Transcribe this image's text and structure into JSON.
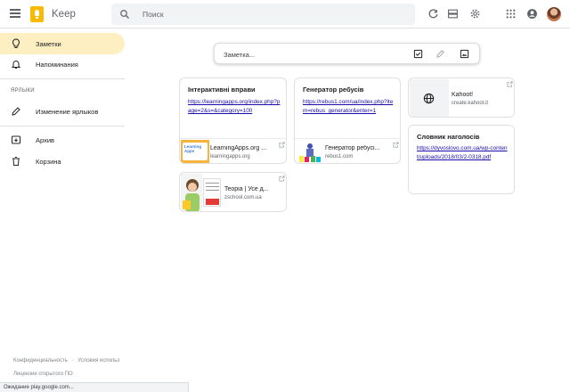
{
  "header": {
    "app_name": "Keep",
    "search_placeholder": "Поиск",
    "icons": [
      "menu-icon",
      "keep-logo-icon",
      "search-icon",
      "refresh-icon",
      "list-view-icon",
      "settings-icon",
      "apps-grid-icon",
      "account-icon"
    ]
  },
  "sidebar": {
    "items": [
      {
        "label": "Заметки",
        "icon": "lightbulb-icon",
        "active": true
      },
      {
        "label": "Напоминания",
        "icon": "bell-icon",
        "active": false
      }
    ],
    "labels_section_title": "ЯРЛЫКИ",
    "edit_labels": {
      "label": "Изменение ярлыков",
      "icon": "pencil-icon"
    },
    "archive": {
      "label": "Архив",
      "icon": "archive-icon"
    },
    "trash": {
      "label": "Корзина",
      "icon": "trash-icon"
    },
    "footer": {
      "privacy": "Конфиденциальность",
      "separator": "·",
      "terms": "Условия использ",
      "licenses": "Лицензии открытого ПО"
    }
  },
  "status_bar": "Ожидание play.google.com...",
  "composer": {
    "placeholder": "Заметка...",
    "icons": [
      "checkbox-list-icon",
      "drawing-icon",
      "image-icon"
    ]
  },
  "notes": [
    {
      "title": "Інтерактивні вправи",
      "link": "https://learningapps.org/index.php?page=2&s=&category=100",
      "preview": {
        "title": "LearningApps.org ...",
        "domain": "learningapps.org",
        "thumb_text": "Learning Apps"
      }
    },
    {
      "title": "Генератор ребусів",
      "link": "https://rebus1.com/ua/index.php?item=rebus_generator&enter=1",
      "preview": {
        "title": "Генератор ребусі...",
        "domain": "rebus1.com"
      }
    },
    {
      "title": "",
      "link": "",
      "preview": {
        "title": "Kahoot!",
        "domain": "create.kahoot.it"
      }
    },
    {
      "title": "Словник наголосів",
      "link": "https://dyvoslovo.com.ua/wp-content/uploads/2018/03/2-0318.pdf",
      "preview": null
    },
    {
      "title": "",
      "link": "",
      "preview": {
        "title": "Teopia | Усе д...",
        "domain": "zschool.com.ua"
      }
    }
  ],
  "colors": {
    "active_nav": "#feefc3",
    "logo": "#f9ba00",
    "link": "#1a0dab",
    "search_bg": "#f1f3f4"
  }
}
